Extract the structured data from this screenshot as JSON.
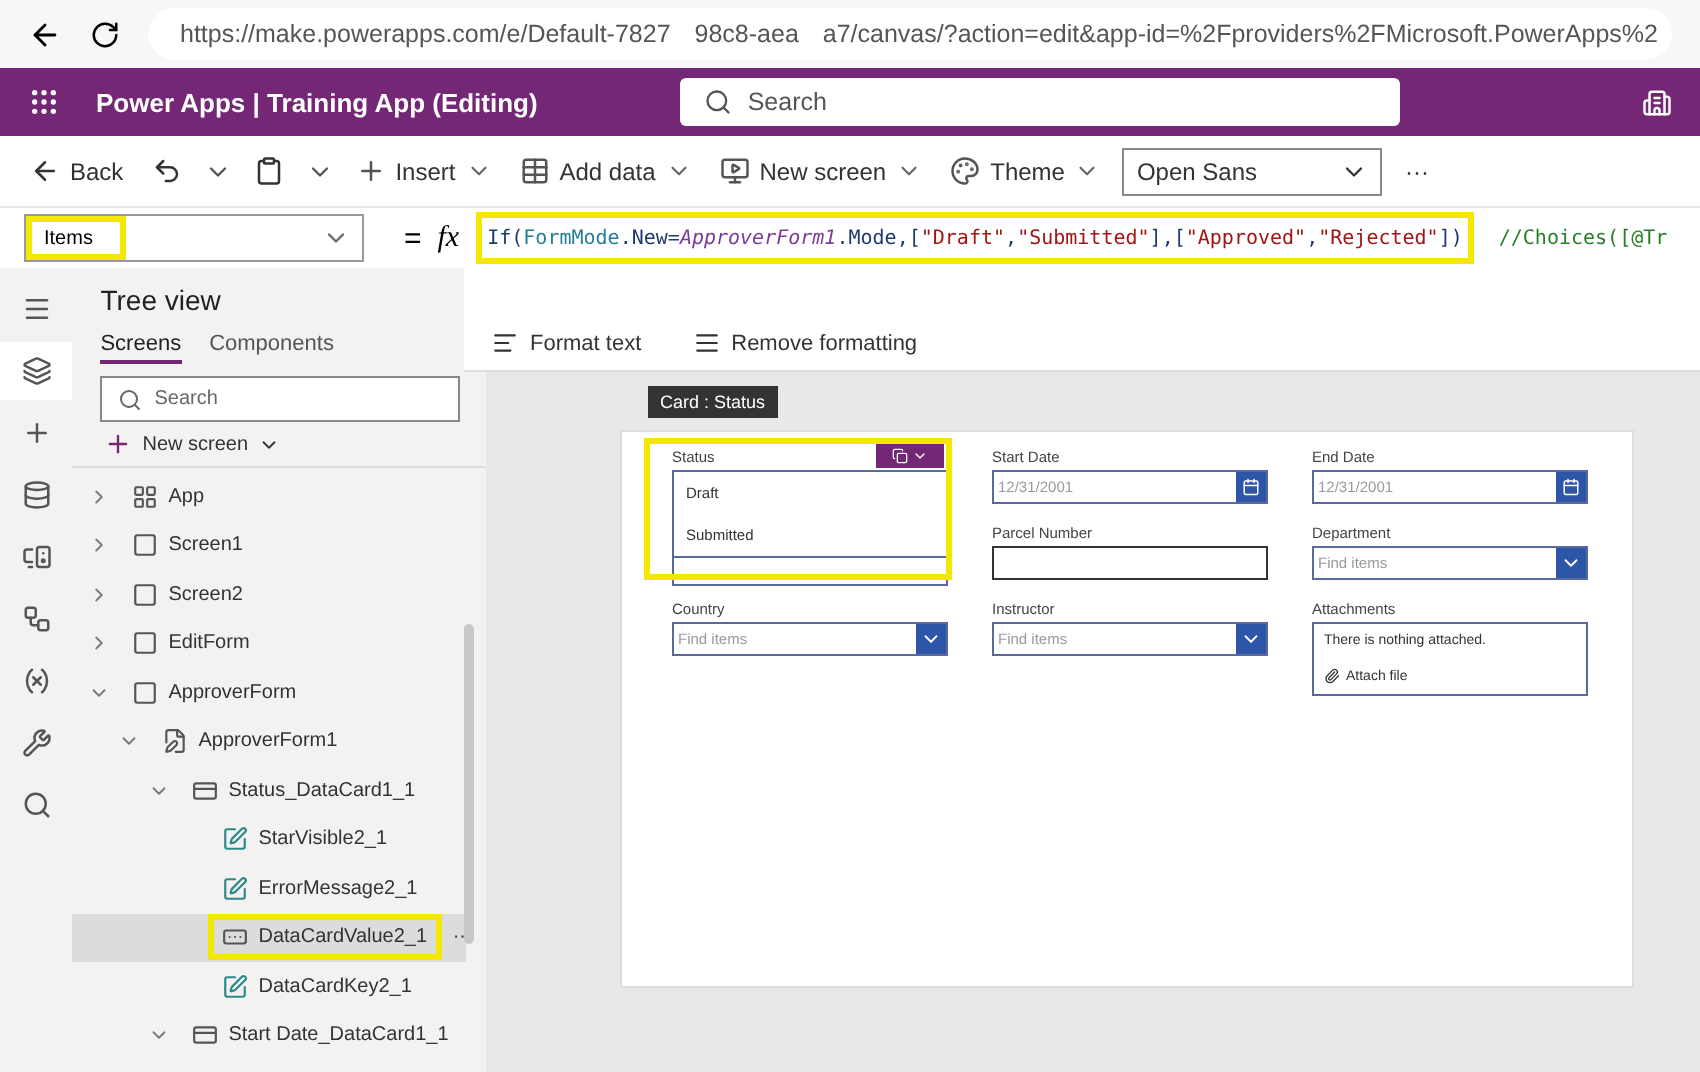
{
  "browser": {
    "url_parts": [
      {
        "kind": "text",
        "text": "https://make.powerapps.com/e/Default-7827"
      },
      {
        "kind": "redacted"
      },
      {
        "kind": "text",
        "text": "98c8-aea"
      },
      {
        "kind": "redacted"
      },
      {
        "kind": "text",
        "text": "a7/canvas/?action=edit&app-id=%2Fproviders%2FMicrosoft.PowerApps%2"
      }
    ]
  },
  "header": {
    "product": "Power Apps",
    "separator": "|",
    "app_title": "Training App (Editing)",
    "search": {
      "placeholder": "Search"
    }
  },
  "commands": [
    {
      "kind": "back",
      "label": "Back"
    },
    {
      "kind": "undo"
    },
    {
      "kind": "paste"
    },
    {
      "kind": "insert",
      "label": "Insert"
    },
    {
      "kind": "data",
      "label": "Add data"
    },
    {
      "kind": "screen",
      "label": "New screen"
    },
    {
      "kind": "theme",
      "label": "Theme"
    },
    {
      "kind": "font",
      "label": "Open Sans"
    },
    {
      "kind": "more",
      "label": "···"
    }
  ],
  "formula_bar": {
    "property": "Items",
    "property_highlighted": true,
    "equals": "=",
    "fx": "fx",
    "formula_highlighted": true,
    "tokens": [
      {
        "kind": "plain",
        "text": "If("
      },
      {
        "kind": "enum",
        "text": "FormMode"
      },
      {
        "kind": "plain",
        "text": ".New="
      },
      {
        "kind": "control",
        "text": "ApproverForm1"
      },
      {
        "kind": "plain",
        "text": ".Mode,["
      },
      {
        "kind": "string",
        "text": "\"Draft\""
      },
      {
        "kind": "plain",
        "text": ","
      },
      {
        "kind": "string",
        "text": "\"Submitted\""
      },
      {
        "kind": "plain",
        "text": "],["
      },
      {
        "kind": "string",
        "text": "\"Approved\""
      },
      {
        "kind": "plain",
        "text": ","
      },
      {
        "kind": "string",
        "text": "\"Rejected\""
      },
      {
        "kind": "plain",
        "text": "])"
      }
    ],
    "comment": "//Choices([@Tr",
    "tools": [
      {
        "kind": "format",
        "label": "Format text"
      },
      {
        "kind": "remove",
        "label": "Remove formatting"
      }
    ]
  },
  "rail": [
    {
      "kind": "menu",
      "selected": false
    },
    {
      "kind": "layers",
      "selected": true
    },
    {
      "kind": "plus",
      "selected": false
    },
    {
      "kind": "data",
      "selected": false
    },
    {
      "kind": "media",
      "selected": false
    },
    {
      "kind": "automate",
      "selected": false
    },
    {
      "kind": "variables",
      "selected": false
    },
    {
      "kind": "tools",
      "selected": false
    },
    {
      "kind": "search",
      "selected": false
    }
  ],
  "tree": {
    "title": "Tree view",
    "tabs": [
      {
        "label": "Screens",
        "selected": true
      },
      {
        "label": "Components",
        "selected": false
      }
    ],
    "search": {
      "placeholder": "Search"
    },
    "new_screen": "New screen",
    "items": [
      {
        "kind": "app",
        "label": "App",
        "expanded": false,
        "selected": false,
        "highlighted": false
      },
      {
        "kind": "screen",
        "label": "Screen1",
        "expanded": false,
        "selected": false,
        "highlighted": false
      },
      {
        "kind": "screen",
        "label": "Screen2",
        "expanded": false,
        "selected": false,
        "highlighted": false
      },
      {
        "kind": "screen",
        "label": "EditForm",
        "expanded": false,
        "selected": false,
        "highlighted": false
      },
      {
        "kind": "screen",
        "label": "ApproverForm",
        "expanded": true,
        "selected": false,
        "highlighted": false,
        "children": [
          {
            "kind": "form",
            "label": "ApproverForm1",
            "expanded": true,
            "selected": false,
            "highlighted": false,
            "children": [
              {
                "kind": "card",
                "label": "Status_DataCard1_1",
                "expanded": true,
                "selected": false,
                "highlighted": false,
                "children": [
                  {
                    "kind": "label",
                    "label": "StarVisible2_1",
                    "selected": false,
                    "highlighted": false
                  },
                  {
                    "kind": "label",
                    "label": "ErrorMessage2_1",
                    "selected": false,
                    "highlighted": false
                  },
                  {
                    "kind": "dropdown",
                    "label": "DataCardValue2_1",
                    "selected": true,
                    "highlighted": true,
                    "more": "··"
                  },
                  {
                    "kind": "label",
                    "label": "DataCardKey2_1",
                    "selected": false,
                    "highlighted": false
                  }
                ]
              },
              {
                "kind": "card",
                "label": "Start Date_DataCard1_1",
                "expanded": true,
                "selected": false,
                "highlighted": false
              }
            ]
          }
        ]
      }
    ]
  },
  "canvas": {
    "tooltip": "Card : Status",
    "fields": [
      {
        "kind": "dropdown",
        "label": "Status",
        "expanded": true,
        "highlighted": true,
        "options": [
          "Draft",
          "Submitted"
        ]
      },
      {
        "kind": "date",
        "label": "Start Date",
        "value": "12/31/2001"
      },
      {
        "kind": "date",
        "label": "End Date",
        "value": "12/31/2001"
      },
      {
        "kind": "text",
        "label": "Parcel Number"
      },
      {
        "kind": "combo",
        "label": "Department",
        "placeholder": "Find items"
      },
      {
        "kind": "combo",
        "label": "Country",
        "placeholder": "Find items"
      },
      {
        "kind": "combo",
        "label": "Instructor",
        "placeholder": "Find items"
      },
      {
        "kind": "attachments",
        "label": "Attachments",
        "empty_text": "There is nothing attached.",
        "attach": "Attach file"
      }
    ]
  }
}
